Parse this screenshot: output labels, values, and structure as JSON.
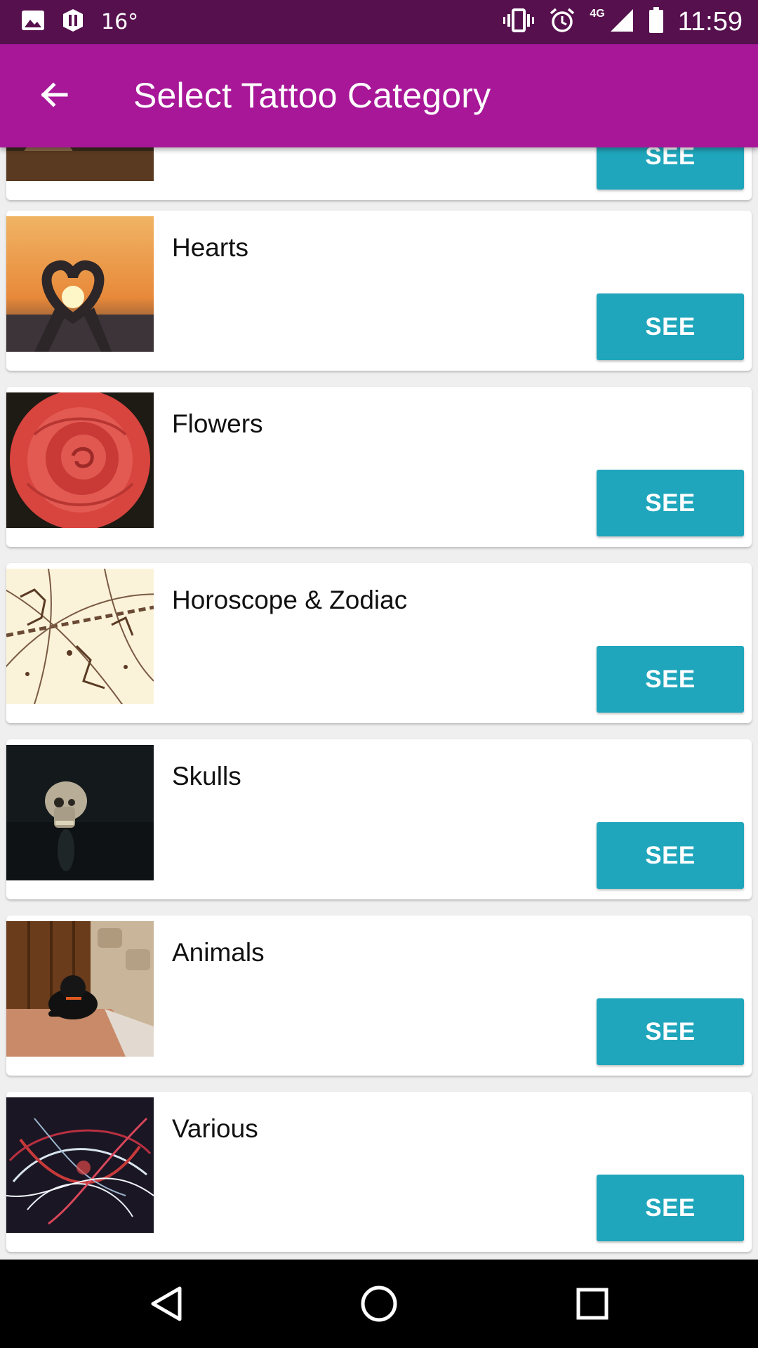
{
  "status_bar": {
    "temperature": "16°",
    "network": "4G",
    "time": "11:59",
    "icons": [
      "image-icon",
      "app-icon",
      "vibrate-icon",
      "alarm-icon",
      "signal-icon",
      "battery-icon"
    ]
  },
  "app_bar": {
    "title": "Select Tattoo Category",
    "back_icon": "arrow-back-icon",
    "color": "#a71798"
  },
  "categories": [
    {
      "title": "",
      "button": "SEE",
      "thumb": "partial"
    },
    {
      "title": "Hearts",
      "button": "SEE",
      "thumb": "hearts"
    },
    {
      "title": "Flowers",
      "button": "SEE",
      "thumb": "flowers"
    },
    {
      "title": "Horoscope & Zodiac",
      "button": "SEE",
      "thumb": "zodiac"
    },
    {
      "title": "Skulls",
      "button": "SEE",
      "thumb": "skulls"
    },
    {
      "title": "Animals",
      "button": "SEE",
      "thumb": "animals"
    },
    {
      "title": "Various",
      "button": "SEE",
      "thumb": "various"
    }
  ],
  "colors": {
    "status_bar": "#56104d",
    "see_button": "#1fa6bc"
  },
  "nav_bar": {
    "icons": [
      "back-triangle-icon",
      "home-circle-icon",
      "recents-square-icon"
    ]
  }
}
